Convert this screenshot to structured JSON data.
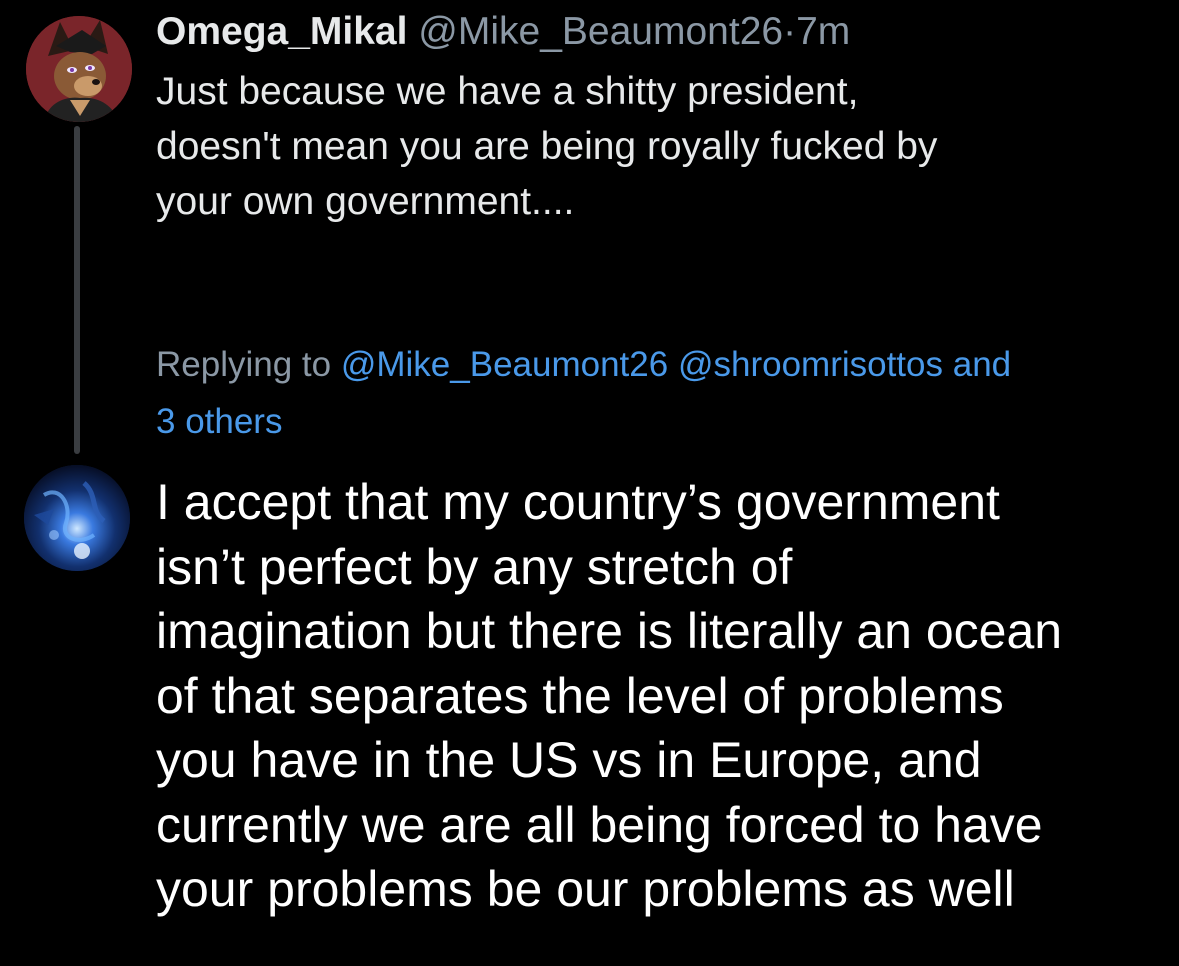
{
  "parent_tweet": {
    "display_name": "Omega_Mikal",
    "handle": "@Mike_Beaumont26",
    "separator": "·",
    "time": "7m",
    "text_lines": [
      "Just because we have a shitty president,",
      "doesn't mean you are being royally fucked by",
      "your own government...."
    ],
    "avatar_icon": "fox-character-avatar-icon"
  },
  "reply": {
    "replying_prefix": "Replying to",
    "mention_1": "@Mike_Beaumont26",
    "mention_2": "@shroomrisottos",
    "mention_3": "and",
    "mention_4": "3 others",
    "text_lines": [
      "I accept that my country’s government",
      "isn’t perfect by any stretch of",
      "imagination but there is literally an ocean",
      "of that separates the level of problems",
      "you have in the US vs in Europe, and",
      "currently we are all being forced to have",
      "your problems be our problems as well"
    ],
    "avatar_icon": "blue-abstract-avatar-icon"
  },
  "colors": {
    "background": "#000000",
    "primary_text": "#e7e9ea",
    "secondary_text": "#8b98a5",
    "link": "#4a99e9",
    "thread_line": "#3a3d41"
  }
}
